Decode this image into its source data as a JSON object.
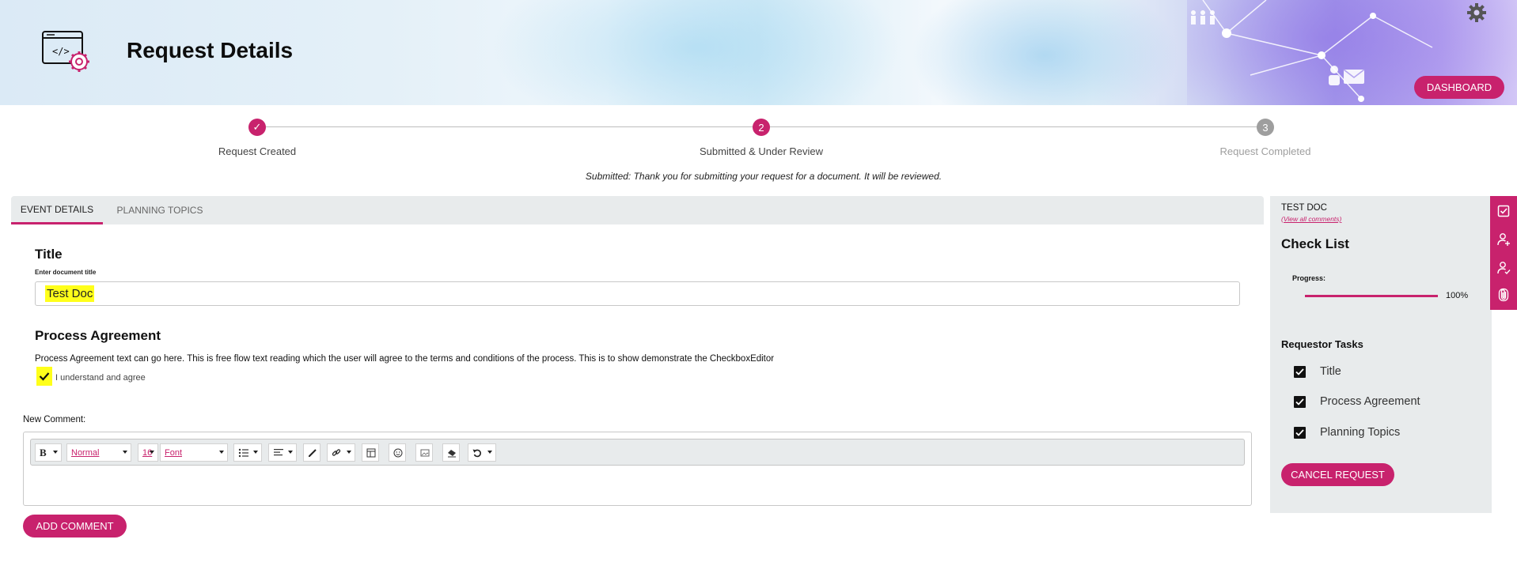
{
  "header": {
    "title": "Request Details",
    "dashboard_label": "DASHBOARD"
  },
  "stepper": {
    "steps": [
      {
        "label": "Request Created",
        "status": "done",
        "marker": "✓"
      },
      {
        "label": "Submitted & Under Review",
        "status": "current",
        "marker": "2"
      },
      {
        "label": "Request Completed",
        "status": "pending",
        "marker": "3"
      }
    ],
    "note": "Submitted: Thank you for submitting your request for a document. It will be reviewed."
  },
  "tabs": [
    {
      "label": "EVENT DETAILS",
      "active": true
    },
    {
      "label": "PLANNING TOPICS",
      "active": false
    }
  ],
  "form": {
    "title_heading": "Title",
    "title_hint": "Enter document title",
    "title_value": "Test Doc",
    "agreement_heading": "Process Agreement",
    "agreement_text": "Process Agreement text can go here. This is free flow text reading which the user will agree to the terms and conditions of the process. This is to show demonstrate the CheckboxEditor",
    "agree_label": "I understand and agree",
    "agree_checked": true,
    "comment_label": "New Comment:",
    "add_comment_label": "ADD COMMENT"
  },
  "editor_toolbar": {
    "bold": "B",
    "style": "Normal",
    "size": "16",
    "font": "Font",
    "icons": [
      "bold-icon",
      "list-icon",
      "align-icon",
      "pen-icon",
      "link-icon",
      "table-icon",
      "emoji-icon",
      "image-icon",
      "eraser-icon",
      "undo-icon"
    ]
  },
  "sidebar": {
    "doc_name": "TEST DOC",
    "view_comments": "(View all comments)",
    "checklist_title": "Check List",
    "progress_label": "Progress:",
    "progress_value": 100,
    "progress_text": "100%",
    "tasks_heading": "Requestor Tasks",
    "tasks": [
      {
        "label": "Title",
        "checked": true
      },
      {
        "label": "Process Agreement",
        "checked": true
      },
      {
        "label": "Planning Topics",
        "checked": true
      }
    ],
    "cancel_label": "CANCEL REQUEST",
    "strip_icons": [
      "checklist-icon",
      "user-add-icon",
      "user-check-icon",
      "attachment-icon"
    ]
  },
  "colors": {
    "accent": "#c8226d",
    "highlight": "#ffff1a",
    "panel": "#e8ebec",
    "pending": "#9e9e9e"
  }
}
